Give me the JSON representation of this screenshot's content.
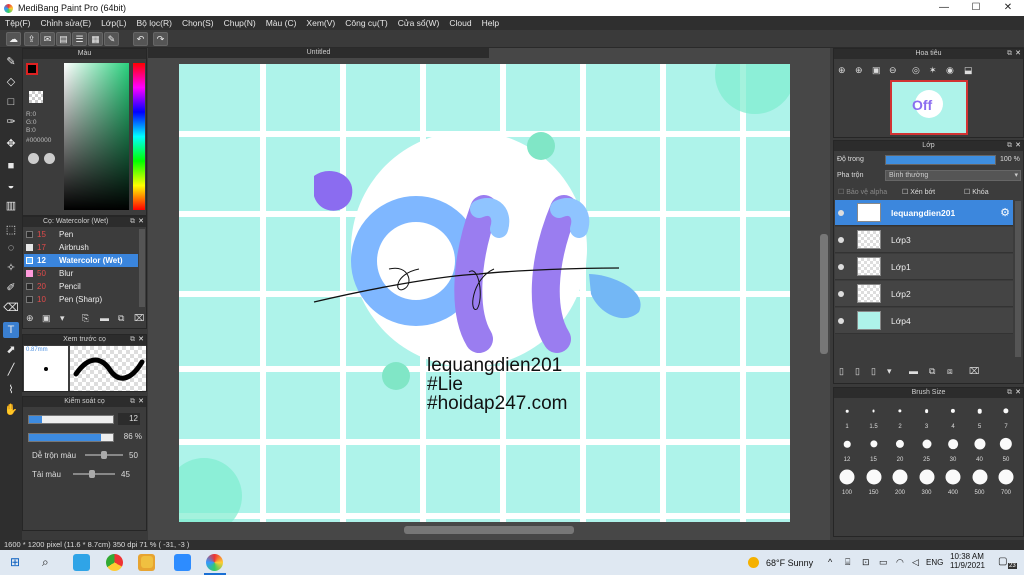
{
  "window": {
    "title": "MediBang Paint Pro (64bit)",
    "min": "—",
    "max": "☐",
    "close": "✕"
  },
  "menu": [
    "Tệp(F)",
    "Chỉnh sửa(E)",
    "Lớp(L)",
    "Bộ lọc(R)",
    "Chọn(S)",
    "Chụp(N)",
    "Màu (C)",
    "Xem(V)",
    "Công cụ(T)",
    "Cửa sổ(W)",
    "Cloud",
    "Help"
  ],
  "color_panel": {
    "title": "Màu",
    "r": "R:0",
    "g": "G:0",
    "b": "B:0",
    "hex": "#000000"
  },
  "canvas_tab": "Untitled",
  "brush_panel": {
    "title": "Cọ: Watercolor (Wet)",
    "items": [
      {
        "num": "15",
        "name": "Pen",
        "color": "#3a3a3a"
      },
      {
        "num": "17",
        "name": "Airbrush",
        "color": "#e8e8e8"
      },
      {
        "num": "12",
        "name": "Watercolor (Wet)",
        "color": "#63b4ff"
      },
      {
        "num": "50",
        "name": "Blur",
        "color": "#ff9bdc"
      },
      {
        "num": "20",
        "name": "Pencil",
        "color": "#3a3a3a"
      },
      {
        "num": "10",
        "name": "Pen (Sharp)",
        "color": "#3a3a3a"
      }
    ]
  },
  "preview_panel": {
    "title": "Xem trước cọ",
    "size": "0.87mm"
  },
  "control_panel": {
    "title": "Kiểm soát cọ",
    "size_value": "12",
    "opacity_value": "86 %",
    "blend_label": "Dễ trộn màu",
    "blend_value": "50",
    "load_label": "Tải màu",
    "load_value": "45",
    "size_fraction": 0.16,
    "opacity_fraction": 0.86,
    "blend_fraction": 0.5,
    "load_fraction": 0.45
  },
  "navigator": {
    "title": "Hoa tiêu"
  },
  "layer_panel": {
    "title": "Lớp",
    "opacity_label": "Độ trong",
    "opacity_value": "100 %",
    "blend_label": "Pha trộn",
    "blend_mode": "Bình thường",
    "protect_alpha": "Bảo vệ alpha",
    "clipping": "Xén bớt",
    "lock": "Khóa",
    "layers": [
      "lequangdien201",
      "Lớp3",
      "Lớp1",
      "Lớp2",
      "Lớp4"
    ]
  },
  "brush_size_panel": {
    "title": "Brush Size",
    "sizes": [
      "1",
      "1.5",
      "2",
      "3",
      "4",
      "5",
      "7",
      "12",
      "15",
      "20",
      "25",
      "30",
      "40",
      "50",
      "100",
      "150",
      "200",
      "300",
      "400",
      "500",
      "700"
    ]
  },
  "canvas_text": {
    "line1": "lequangdien201",
    "line2": "#Lie",
    "line3": "#hoidap247.com",
    "art": "Off"
  },
  "status": "1600 * 1200 pixel   (11.6 * 8.7cm)   350 dpi   71 %   ( -31, -3 )",
  "taskbar": {
    "weather": "68°F  Sunny",
    "lang": "ENG",
    "time": "10:38 AM",
    "date": "11/9/2021",
    "badge": "23"
  }
}
